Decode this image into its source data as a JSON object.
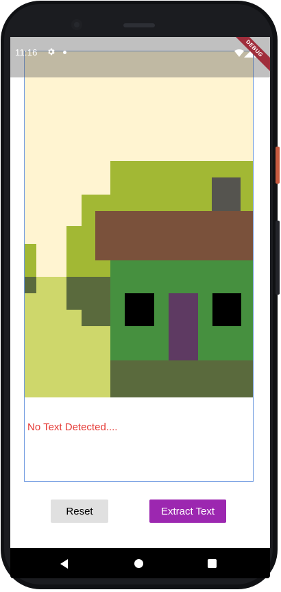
{
  "status_bar": {
    "time": "11:16",
    "icons": [
      "gear-icon",
      "notification-dot",
      "wifi-icon",
      "signal-icon",
      "battery-icon"
    ],
    "debug_banner": "DEBUG"
  },
  "image": {
    "description_icon": "house-pixel-art-image"
  },
  "result": {
    "text": "No Text Detected....",
    "color": "#e53935"
  },
  "buttons": {
    "reset_label": "Reset",
    "extract_label": "Extract Text",
    "extract_color": "#9c27b0",
    "reset_color": "#e0e0e0"
  },
  "nav": {
    "icons": [
      "back-icon",
      "home-icon",
      "recents-icon"
    ]
  }
}
